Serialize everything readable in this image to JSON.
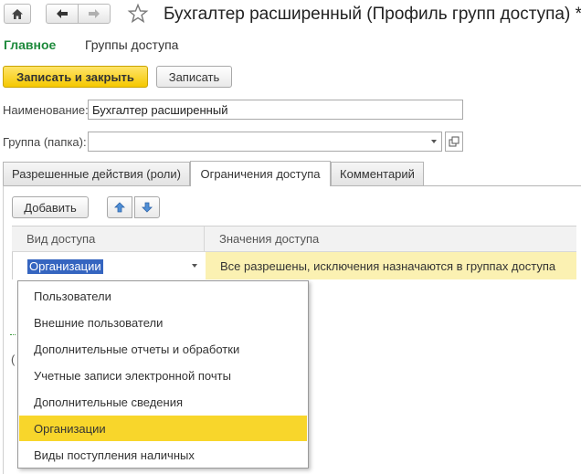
{
  "window": {
    "title": "Бухгалтер расширенный (Профиль групп доступа) *"
  },
  "sections": {
    "main": "Главное",
    "groups": "Группы доступа"
  },
  "toolbar": {
    "save_close": "Записать и закрыть",
    "save": "Записать"
  },
  "form": {
    "name_label": "Наименование:",
    "name_value": "Бухгалтер расширенный",
    "group_label": "Группа (папка):",
    "group_value": ""
  },
  "tabs": [
    {
      "label": "Разрешенные действия (роли)"
    },
    {
      "label": "Ограничения доступа"
    },
    {
      "label": "Комментарий"
    }
  ],
  "panel": {
    "add_button": "Добавить"
  },
  "table": {
    "columns": [
      "Вид доступа",
      "Значения доступа"
    ],
    "row": {
      "kind": "Организации",
      "values": "Все разрешены, исключения назначаются в группах доступа"
    }
  },
  "dropdown": {
    "items": [
      "Пользователи",
      "Внешние пользователи",
      "Дополнительные отчеты и обработки",
      "Учетные записи электронной почты",
      "Дополнительные сведения",
      "Организации",
      "Виды поступления наличных"
    ],
    "selected_index": 5
  },
  "colors": {
    "accent_green": "#1e8a3c",
    "primary_button": "#f5c800",
    "selection_highlight": "#f8d62b",
    "row_values_bg": "#fbf1b2",
    "text_selection": "#3565c0"
  }
}
